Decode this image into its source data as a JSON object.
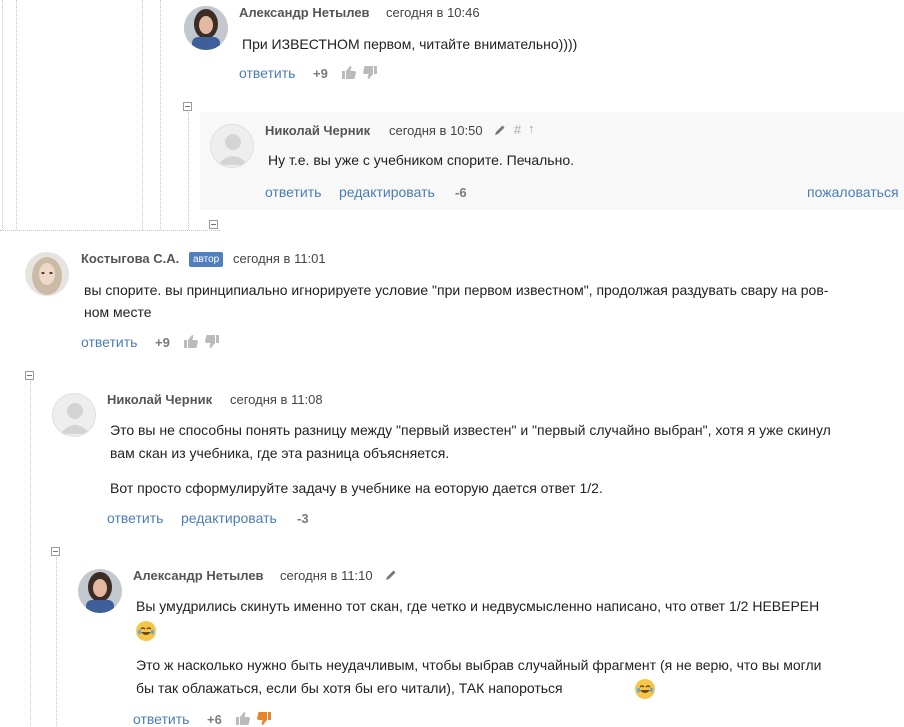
{
  "comments": [
    {
      "author": "Александр Нетылев",
      "date": "сегодня в 10:46",
      "text": "При ИЗВЕСТНОМ первом, читайте внимательно))))",
      "actions": {
        "reply": "ответить"
      },
      "score": "+9"
    },
    {
      "author": "Николай Черник",
      "date": "сегодня в 10:50",
      "meta_icons": [
        "pencil-icon",
        "hash-icon",
        "arrow-up-icon"
      ],
      "hash": "#",
      "arrow": "↑",
      "text": "Ну т.е. вы уже с учебником спорите. Печально.",
      "actions": {
        "reply": "ответить",
        "edit": "редактировать",
        "report": "пожаловаться"
      },
      "score": "-6"
    },
    {
      "author": "Костыгова С.А.",
      "badge": "автор",
      "date": "сегодня в 11:01",
      "text": "вы спорите. вы принципиально игнорируете условие \"при первом известном\", продолжая раздувать свару на ров-ном месте",
      "line1": "вы спорите. вы принципиально игнорируете условие \"при первом известном\", продолжая раздувать свару на ров-",
      "line2": "ном месте",
      "actions": {
        "reply": "ответить"
      },
      "score": "+9"
    },
    {
      "author": "Николай Черник",
      "date": "сегодня в 11:08",
      "p1_line1": "Это вы не способны понять разницу между \"первый известен\" и \"первый случайно выбран\", хотя я уже скинул",
      "p1_line2": "вам скан из учебника, где эта разница объясняется.",
      "p2": "Вот просто сформулируйте задачу в учебнике на еоторую дается ответ 1/2.",
      "actions": {
        "reply": "ответить",
        "edit": "редактировать"
      },
      "score": "-3"
    },
    {
      "author": "Александр Нетылев",
      "date": "сегодня в 11:10",
      "meta_icons": [
        "pencil-icon"
      ],
      "p1": "Вы умудрились скинуть именно тот скан, где четко и недвусмысленно написано, что ответ 1/2 НЕВЕРЕН",
      "p2_line1": "Это ж насколько нужно быть неудачливым, чтобы выбрав случайный фрагмент (я не верю, что вы могли",
      "p2_line2": "бы так облажаться, если бы хотя бы его читали), ТАК напороться",
      "emoji": "tears-of-joy-emoji",
      "actions": {
        "reply": "ответить"
      },
      "score": "+6"
    }
  ],
  "colors": {
    "link": "#4a7db8",
    "author": "#555555",
    "badge": "#4f7fbf",
    "thumb": "#bbbbbb",
    "thumb_down_active": "#e8862e",
    "highlight_bg": "#f8f8f8"
  }
}
